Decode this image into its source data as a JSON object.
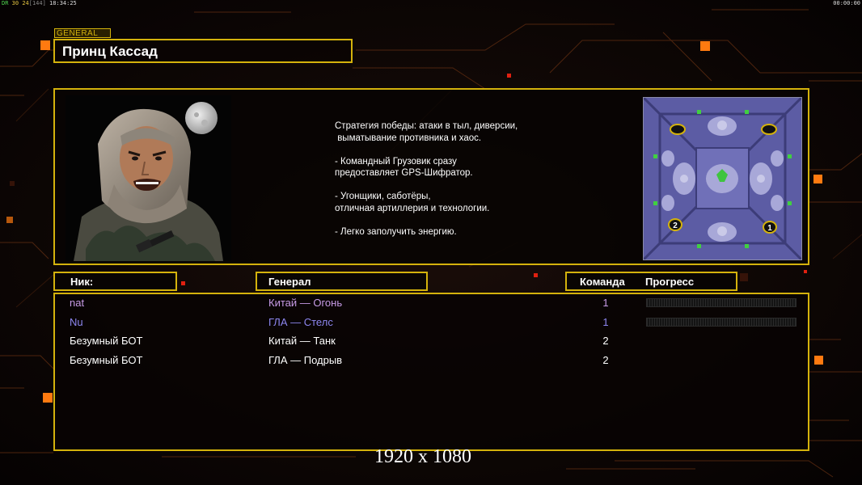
{
  "hud": {
    "left_prefix": "DR",
    "fps": "30",
    "speed": "24",
    "speed_bracket": "[144]",
    "clock": "18:34:25",
    "timer": "00:00:00"
  },
  "general_tag": "GENERAL",
  "title": "Принц Кассад",
  "description": [
    "Стратегия победы: атаки в тыл, диверсии,",
    " выматывание противника и хаос.",
    "",
    "- Командный Грузовик сразу",
    "предоставляет GPS-Шифратор.",
    "",
    "- Угонщики, саботёры,",
    "отличная артиллерия и технологии.",
    "",
    "- Легко заполучить энергию."
  ],
  "minimap": {
    "start_positions": [
      "2",
      "1"
    ]
  },
  "headers": {
    "nick": "Ник:",
    "general": "Генерал",
    "team": "Команда",
    "progress": "Прогресс"
  },
  "players": [
    {
      "nick": "nat",
      "general": "Китай — Огонь",
      "team": "1",
      "color": "#c79be6",
      "progress": 0,
      "show_progress": true
    },
    {
      "nick": "Nu",
      "general": "ГЛА — Стелс",
      "team": "1",
      "color": "#8d86f0",
      "progress": 0,
      "show_progress": true
    },
    {
      "nick": "Безумный БОТ",
      "general": "Китай — Танк",
      "team": "2",
      "color": "#ffffff",
      "progress": 0,
      "show_progress": false
    },
    {
      "nick": "Безумный БОТ",
      "general": "ГЛА — Подрыв",
      "team": "2",
      "color": "#ffffff",
      "progress": 0,
      "show_progress": false
    }
  ],
  "resolution_label": "1920 x 1080",
  "colors": {
    "frame": "#d4b20c",
    "accent_orange": "#ff7a10",
    "accent_red": "#e02010"
  }
}
